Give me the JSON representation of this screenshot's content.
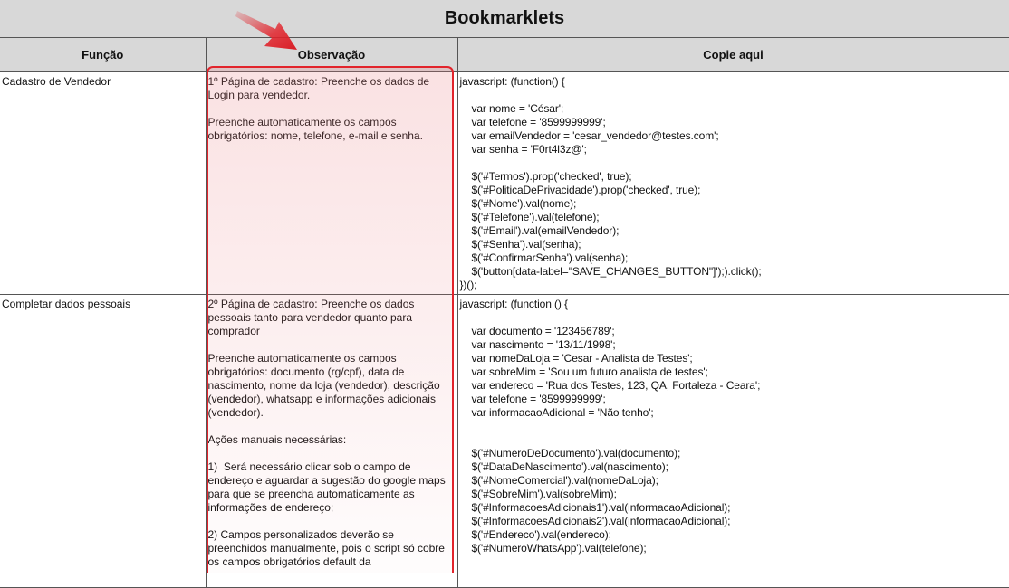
{
  "page": {
    "title": "Bookmarklets"
  },
  "table": {
    "headers": [
      "Função",
      "Observação",
      "Copie aqui"
    ],
    "rows": [
      {
        "funcao": "Cadastro de Vendedor",
        "observacao": "1º Página de cadastro: Preenche os dados de Login para vendedor.\n\nPreenche automaticamente os campos obrigatórios: nome, telefone, e-mail e senha.",
        "codigo": "javascript: (function() {\n\n    var nome = 'César';\n    var telefone = '8599999999';\n    var emailVendedor = 'cesar_vendedor@testes.com';\n    var senha = 'F0rt4l3z@';\n\n    $('#Termos').prop('checked', true);\n    $('#PoliticaDePrivacidade').prop('checked', true);\n    $('#Nome').val(nome);\n    $('#Telefone').val(telefone);\n    $('#Email').val(emailVendedor);\n    $('#Senha').val(senha);\n    $('#ConfirmarSenha').val(senha);\n    $('button[data-label=\"SAVE_CHANGES_BUTTON\"]');).click();\n})();"
      },
      {
        "funcao": "Completar dados pessoais",
        "observacao": "2º Página de cadastro: Preenche os dados pessoais tanto para vendedor quanto para comprador\n\nPreenche automaticamente os campos obrigatórios: documento (rg/cpf), data de nascimento, nome da loja (vendedor), descrição (vendedor), whatsapp e informações adicionais (vendedor).\n\nAções manuais necessárias:\n\n1)  Será necessário clicar sob o campo de endereço e aguardar a sugestão do google maps para que se preencha automaticamente as informações de endereço;\n\n2) Campos personalizados deverão se preenchidos manualmente, pois o script só cobre os campos obrigatórios default da",
        "codigo": "javascript: (function () {\n\n    var documento = '123456789';\n    var nascimento = '13/11/1998';\n    var nomeDaLoja = 'Cesar - Analista de Testes';\n    var sobreMim = 'Sou um futuro analista de testes';\n    var endereco = 'Rua dos Testes, 123, QA, Fortaleza - Ceara';\n    var telefone = '8599999999';\n    var informacaoAdicional = 'Não tenho';\n\n\n    $('#NumeroDeDocumento').val(documento);\n    $('#DataDeNascimento').val(nascimento);\n    $('#NomeComercial').val(nomeDaLoja);\n    $('#SobreMim').val(sobreMim);\n    $('#InformacoesAdicionais1').val(informacaoAdicional);\n    $('#InformacoesAdicionais2').val(informacaoAdicional);\n    $('#Endereco').val(endereco);\n    $('#NumeroWhatsApp').val(telefone);"
      }
    ]
  },
  "annotation": {
    "arrow_icon": "red-arrow-icon",
    "highlight_color": "#e2242c"
  }
}
